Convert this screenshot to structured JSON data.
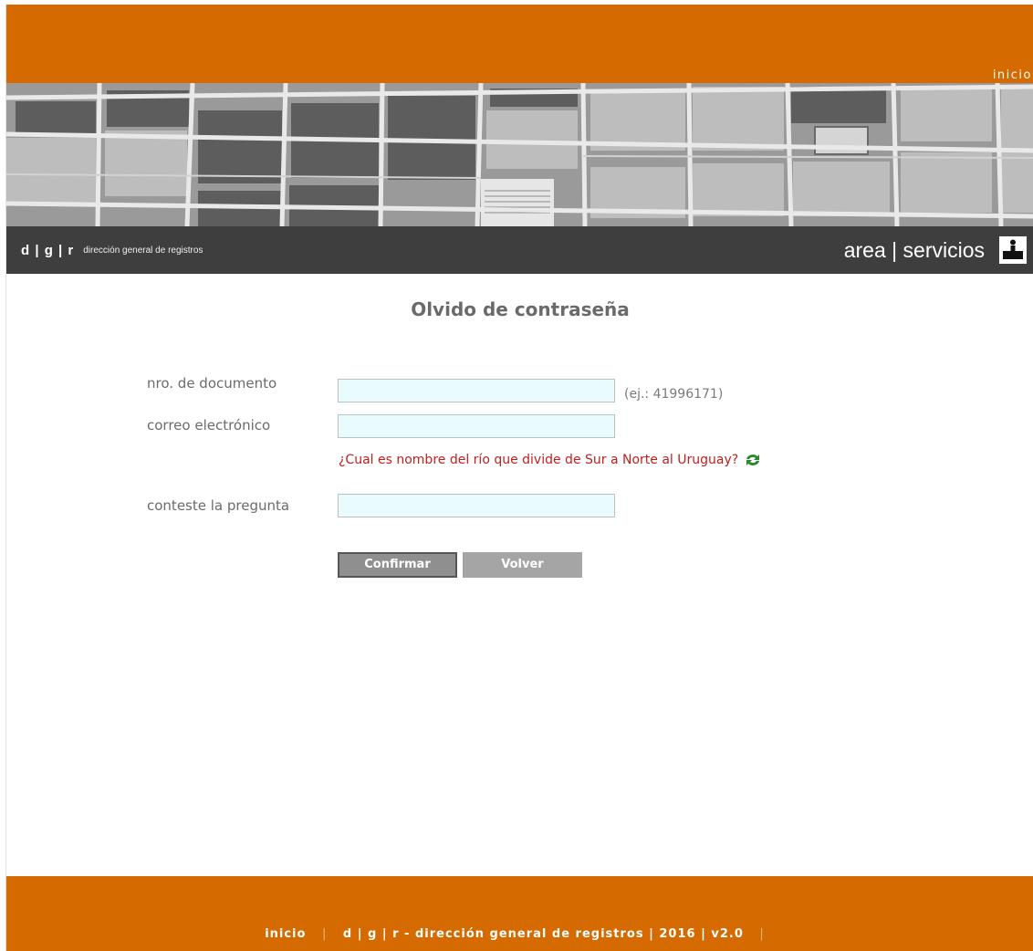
{
  "header": {
    "top_link": "inicio"
  },
  "navbar": {
    "brand_mark": "d | g | r",
    "brand_name": "dirección general de registros",
    "area_services": "area | servicios",
    "desk_icon": "desk-person-icon"
  },
  "form": {
    "title": "Olvido de contraseña",
    "document_label": "nro. de documento",
    "document_value": "",
    "document_hint": "(ej.: 41996171)",
    "email_label": "correo electrónico",
    "email_value": "",
    "question": "¿Cual es nombre del río que divide de Sur a Norte al Uruguay?",
    "refresh_icon": "refresh-icon",
    "answer_label": "conteste la pregunta",
    "answer_value": "",
    "confirm_label": "Confirmar",
    "back_label": "Volver"
  },
  "footer": {
    "home_link": "inicio",
    "text": "d | g | r - dirección general de registros | 2016 | v2.0"
  },
  "colors": {
    "orange": "#d56a00",
    "dark_nav": "#3e3e3e",
    "field_bg": "#e9fbfc",
    "question_red": "#c21e1e",
    "refresh_green": "#2a8a2a"
  }
}
